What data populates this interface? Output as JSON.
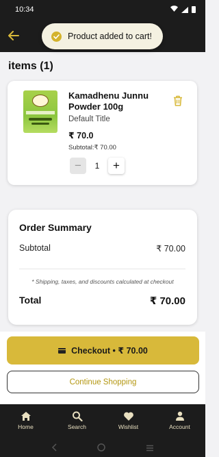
{
  "status_bar": {
    "time": "10:34"
  },
  "toast": {
    "message": "Product added to cart!"
  },
  "items_heading": "items (1)",
  "cart_item": {
    "name": "Kamadhenu Junnu Powder 100g",
    "variant": "Default Title",
    "price": "₹ 70.0",
    "subtotal": "Subtotal:₹ 70.00",
    "quantity": "1",
    "minus": "−",
    "plus": "+"
  },
  "order_summary": {
    "title": "Order Summary",
    "subtotal_label": "Subtotal",
    "subtotal_value": "₹ 70.00",
    "note": "* Shipping, taxes, and discounts calculated at checkout",
    "total_label": "Total",
    "total_value": "₹ 70.00"
  },
  "buttons": {
    "checkout": "Checkout • ₹ 70.00",
    "continue": "Continue Shopping"
  },
  "bottom_nav": [
    {
      "label": "Home",
      "icon": "home-icon"
    },
    {
      "label": "Search",
      "icon": "search-icon"
    },
    {
      "label": "Wishlist",
      "icon": "heart-icon"
    },
    {
      "label": "Account",
      "icon": "person-icon"
    }
  ],
  "colors": {
    "accent": "#d8b93a",
    "dark": "#1c1c1c",
    "continue_text": "#b3960f"
  }
}
